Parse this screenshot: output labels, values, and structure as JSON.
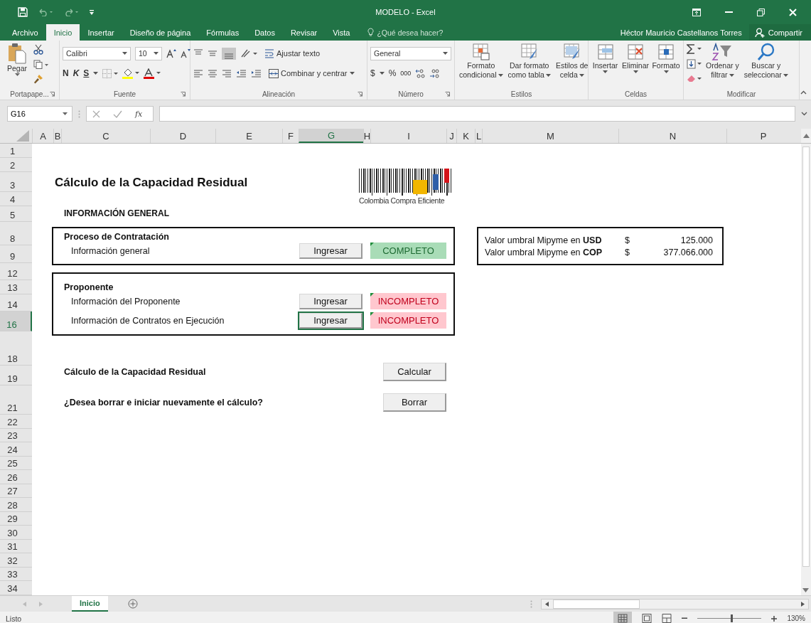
{
  "window": {
    "title": "MODELO - Excel"
  },
  "tabs": [
    {
      "label": "Archivo",
      "selected": false
    },
    {
      "label": "Inicio",
      "selected": true
    },
    {
      "label": "Insertar",
      "selected": false
    },
    {
      "label": "Diseño de página",
      "selected": false
    },
    {
      "label": "Fórmulas",
      "selected": false
    },
    {
      "label": "Datos",
      "selected": false
    },
    {
      "label": "Revisar",
      "selected": false
    },
    {
      "label": "Vista",
      "selected": false
    }
  ],
  "tell_me": {
    "placeholder": "¿Qué desea hacer?"
  },
  "user": "Héctor Mauricio Castellanos Torres",
  "share_button": "Compartir",
  "ribbon": {
    "clipboard": {
      "paste": "Pegar",
      "group": "Portapape..."
    },
    "font": {
      "name": "Calibri",
      "size": "10",
      "bold": "N",
      "italic": "K",
      "underline": "S",
      "group": "Fuente"
    },
    "alignment": {
      "wrap": "Ajustar texto",
      "merge": "Combinar y centrar",
      "group": "Alineación"
    },
    "number": {
      "format": "General",
      "currency": "$",
      "percent": "%",
      "thousands": "000",
      "group": "Número"
    },
    "styles": {
      "buttons": [
        [
          "Formato",
          "condicional"
        ],
        [
          "Dar formato",
          "como tabla"
        ],
        [
          "Estilos de",
          "celda"
        ]
      ],
      "group": "Estilos"
    },
    "cells": {
      "buttons": [
        "Insertar",
        "Eliminar",
        "Formato"
      ],
      "group": "Celdas"
    },
    "editing": {
      "buttons": [
        [
          "Ordenar y",
          "filtrar"
        ],
        [
          "Buscar y",
          "seleccionar"
        ]
      ],
      "group": "Modificar"
    }
  },
  "formula_bar": {
    "name_box": "G16",
    "function_label": "fx"
  },
  "sheet": {
    "columns": [
      {
        "label": "A",
        "selected": false
      },
      {
        "label": "B",
        "selected": false
      },
      {
        "label": "C",
        "selected": false
      },
      {
        "label": "D",
        "selected": false
      },
      {
        "label": "E",
        "selected": false
      },
      {
        "label": "F",
        "selected": false
      },
      {
        "label": "G",
        "selected": true
      },
      {
        "label": "H",
        "selected": false
      },
      {
        "label": "I",
        "selected": false
      },
      {
        "label": "J",
        "selected": false
      },
      {
        "label": "K",
        "selected": false
      },
      {
        "label": "L",
        "selected": false
      },
      {
        "label": "M",
        "selected": false
      },
      {
        "label": "N",
        "selected": false
      },
      {
        "label": "P",
        "selected": false
      }
    ],
    "rows": [
      {
        "label": "1",
        "selected": false
      },
      {
        "label": "2",
        "selected": false
      },
      {
        "label": "3",
        "selected": false
      },
      {
        "label": "4",
        "selected": false
      },
      {
        "label": "5",
        "selected": false
      },
      {
        "label": "8",
        "selected": false
      },
      {
        "label": "9",
        "selected": false
      },
      {
        "label": "12",
        "selected": false
      },
      {
        "label": "13",
        "selected": false
      },
      {
        "label": "14",
        "selected": false
      },
      {
        "label": "16",
        "selected": true
      },
      {
        "label": "18",
        "selected": false
      },
      {
        "label": "19",
        "selected": false
      },
      {
        "label": "21",
        "selected": false
      },
      {
        "label": "22",
        "selected": false
      },
      {
        "label": "23",
        "selected": false
      },
      {
        "label": "24",
        "selected": false
      },
      {
        "label": "25",
        "selected": false
      },
      {
        "label": "26",
        "selected": false
      },
      {
        "label": "27",
        "selected": false
      },
      {
        "label": "28",
        "selected": false
      },
      {
        "label": "29",
        "selected": false
      },
      {
        "label": "30",
        "selected": false
      },
      {
        "label": "31",
        "selected": false
      },
      {
        "label": "32",
        "selected": false
      },
      {
        "label": "33",
        "selected": false
      },
      {
        "label": "34",
        "selected": false
      }
    ],
    "title": "Cálculo de la Capacidad Residual",
    "logo_text": "Colombia Compra Eficiente",
    "section": "INFORMACIÓN GENERAL",
    "groups": [
      {
        "heading": "Proceso de Contratación",
        "items": [
          {
            "label": "Información general",
            "button": "Ingresar",
            "selected": false,
            "status": "COMPLETO",
            "complete": true
          }
        ]
      },
      {
        "heading": "Proponente",
        "items": [
          {
            "label": "Información del Proponente",
            "button": "Ingresar",
            "selected": false,
            "status": "INCOMPLETO",
            "complete": false
          },
          {
            "label": "Información de Contratos en Ejecución",
            "button": "Ingresar",
            "selected": true,
            "status": "INCOMPLETO",
            "complete": false
          }
        ]
      }
    ],
    "thresholds": [
      {
        "label": "Valor umbral Mipyme en **USD**",
        "currency": "$",
        "value": "125.000"
      },
      {
        "label": "Valor umbral Mipyme en **COP**",
        "currency": "$",
        "value": "377.066.000"
      }
    ],
    "actions": [
      {
        "label": "Cálculo de la Capacidad Residual",
        "button": "Calcular"
      },
      {
        "label": "¿Desea borrar e iniciar nuevamente el cálculo?",
        "button": "Borrar"
      }
    ]
  },
  "sheet_tabs": [
    {
      "label": "Inicio",
      "selected": true
    }
  ],
  "status_bar": {
    "text": "Listo",
    "zoom": "130%",
    "zoom_slider": {
      "level": 0.52
    }
  }
}
